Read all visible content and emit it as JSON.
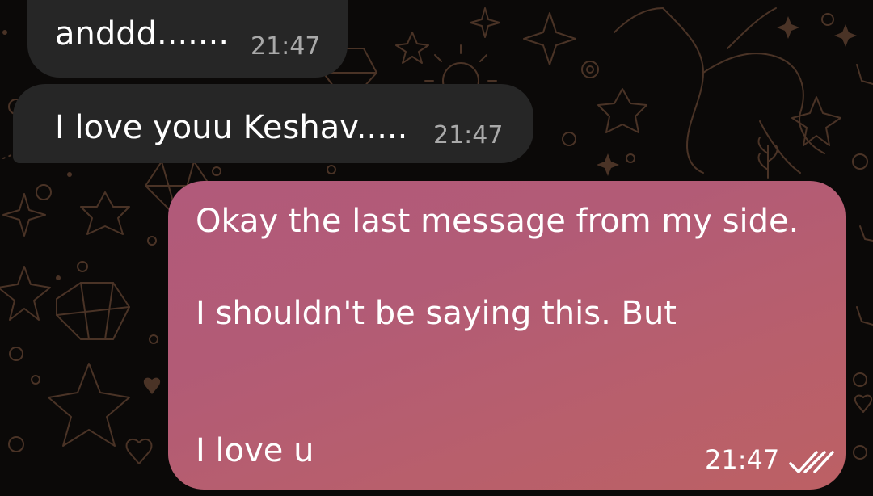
{
  "messages": [
    {
      "direction": "incoming",
      "text": "anddd.......",
      "time": "21:47"
    },
    {
      "direction": "incoming",
      "text": "I love youu Keshav.....",
      "time": "21:47"
    },
    {
      "direction": "outgoing",
      "lines": [
        "Okay the last message from my side.",
        "I shouldn't be saying  this.  But",
        "I love u"
      ],
      "time": "21:47",
      "status": "read-double-check-icon"
    }
  ],
  "colors": {
    "incoming_bubble": "#262626",
    "outgoing_bubble_start": "#b15a7a",
    "outgoing_bubble_end": "#bc6064",
    "wallpaper_bg": "#0b0908",
    "wallpaper_doodle": "#4a3326",
    "timestamp_incoming": "#a9a9a9"
  }
}
